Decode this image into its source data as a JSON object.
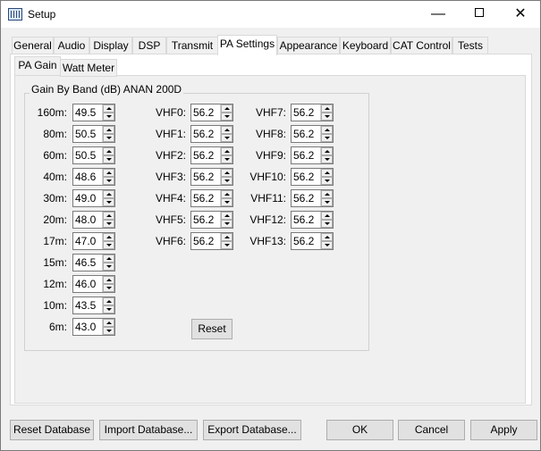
{
  "window": {
    "title": "Setup"
  },
  "tabs": [
    "General",
    "Audio",
    "Display",
    "DSP",
    "Transmit",
    "PA Settings",
    "Appearance",
    "Keyboard",
    "CAT Control",
    "Tests"
  ],
  "subtabs": [
    "PA Gain",
    "Watt Meter"
  ],
  "group": {
    "title": "Gain By Band (dB) ANAN 200D"
  },
  "hf_bands": [
    {
      "label": "160m:",
      "value": "49.5"
    },
    {
      "label": "80m:",
      "value": "50.5"
    },
    {
      "label": "60m:",
      "value": "50.5"
    },
    {
      "label": "40m:",
      "value": "48.6"
    },
    {
      "label": "30m:",
      "value": "49.0"
    },
    {
      "label": "20m:",
      "value": "48.0"
    },
    {
      "label": "17m:",
      "value": "47.0"
    },
    {
      "label": "15m:",
      "value": "46.5"
    },
    {
      "label": "12m:",
      "value": "46.0"
    },
    {
      "label": "10m:",
      "value": "43.5"
    },
    {
      "label": "6m:",
      "value": "43.0"
    }
  ],
  "vhf_bands_a": [
    {
      "label": "VHF0:",
      "value": "56.2"
    },
    {
      "label": "VHF1:",
      "value": "56.2"
    },
    {
      "label": "VHF2:",
      "value": "56.2"
    },
    {
      "label": "VHF3:",
      "value": "56.2"
    },
    {
      "label": "VHF4:",
      "value": "56.2"
    },
    {
      "label": "VHF5:",
      "value": "56.2"
    },
    {
      "label": "VHF6:",
      "value": "56.2"
    }
  ],
  "vhf_bands_b": [
    {
      "label": "VHF7:",
      "value": "56.2"
    },
    {
      "label": "VHF8:",
      "value": "56.2"
    },
    {
      "label": "VHF9:",
      "value": "56.2"
    },
    {
      "label": "VHF10:",
      "value": "56.2"
    },
    {
      "label": "VHF11:",
      "value": "56.2"
    },
    {
      "label": "VHF12:",
      "value": "56.2"
    },
    {
      "label": "VHF13:",
      "value": "56.2"
    }
  ],
  "reset_label": "Reset",
  "footer": {
    "reset_db": "Reset Database",
    "import_db": "Import Database...",
    "export_db": "Export Database...",
    "ok": "OK",
    "cancel": "Cancel",
    "apply": "Apply"
  }
}
